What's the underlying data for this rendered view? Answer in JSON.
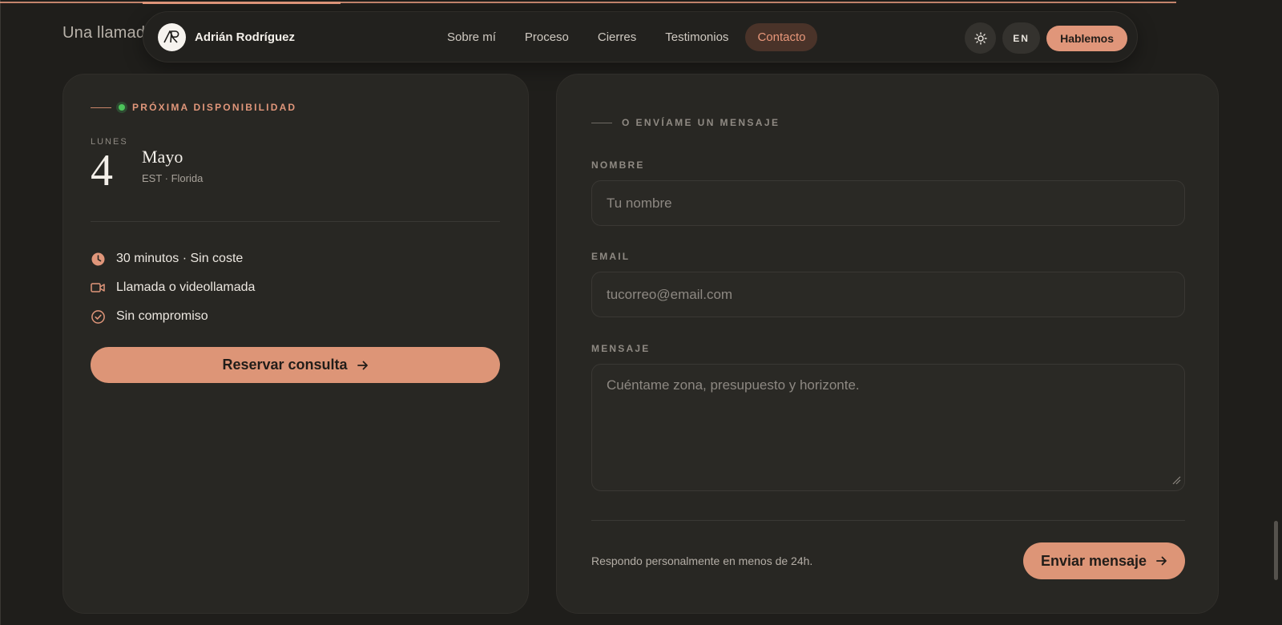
{
  "background_heading": "Una llamad",
  "nav": {
    "brand_name": "Adrián Rodríguez",
    "links": [
      "Sobre mí",
      "Proceso",
      "Cierres",
      "Testimonios",
      "Contacto"
    ],
    "active_link": "Contacto",
    "theme_icon": "sun-icon",
    "lang_label": "EN",
    "cta_label": "Hablemos"
  },
  "availability": {
    "kicker": "PRÓXIMA DISPONIBILIDAD",
    "weekday": "LUNES",
    "day": "4",
    "month": "Mayo",
    "timezone": "EST · Florida",
    "features": [
      {
        "icon": "clock-icon",
        "text": "30 minutos · Sin coste"
      },
      {
        "icon": "video-icon",
        "text": "Llamada o videollamada"
      },
      {
        "icon": "check-circle-icon",
        "text": "Sin compromiso"
      }
    ],
    "book_button": "Reservar consulta"
  },
  "form": {
    "kicker": "O ENVÍAME UN MENSAJE",
    "name_label": "NOMBRE",
    "name_placeholder": "Tu nombre",
    "email_label": "EMAIL",
    "email_placeholder": "tucorreo@email.com",
    "message_label": "MENSAJE",
    "message_placeholder": "Cuéntame zona, presupuesto y horizonte.",
    "footnote": "Respondo personalmente en menos de 24h.",
    "send_button": "Enviar mensaje"
  },
  "colors": {
    "accent": "#e0967a",
    "background": "#1f1e1b",
    "card": "#282723",
    "status_green": "#4cc45a"
  }
}
